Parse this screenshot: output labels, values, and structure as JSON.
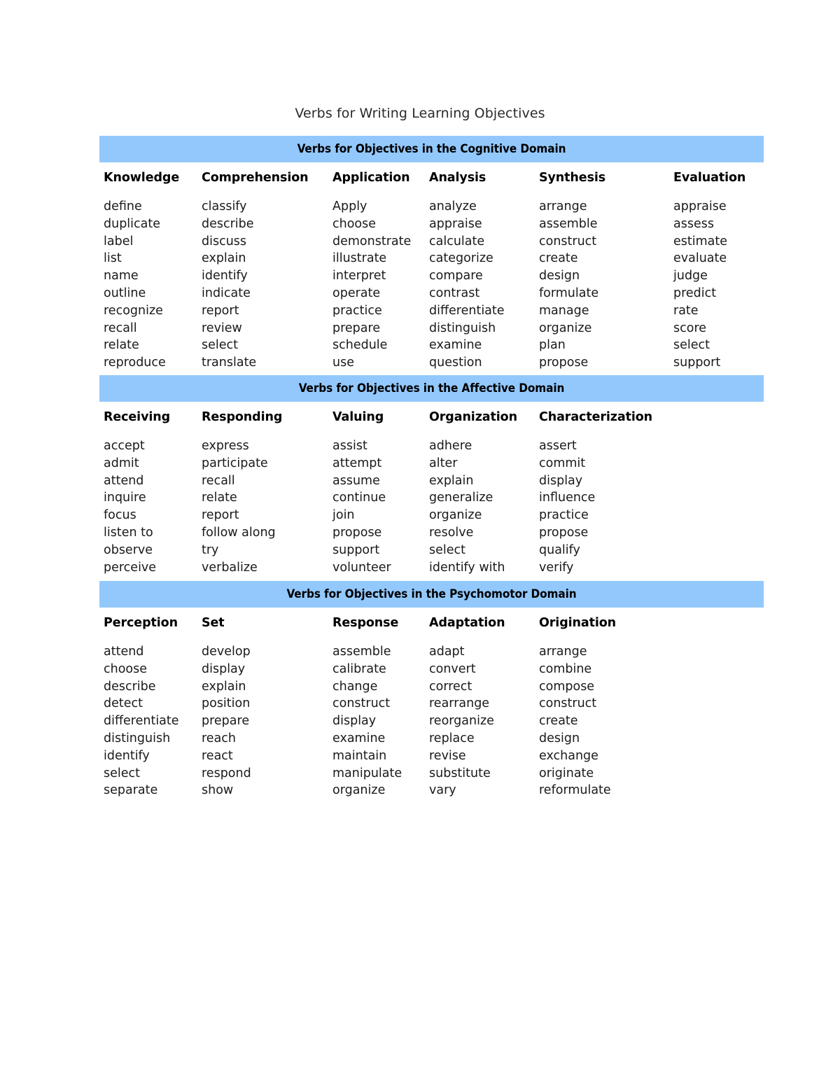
{
  "document": {
    "title": "Verbs for Writing Learning Objectives",
    "band_color": "#93C8FD",
    "text_color": "#000000"
  },
  "sections": [
    {
      "band_title": "Verbs for Objectives in the Cognitive Domain",
      "columns": [
        {
          "header": "Knowledge",
          "words": [
            "define",
            "duplicate",
            "label",
            "list",
            "name",
            "outline",
            "recognize",
            "recall",
            "relate",
            "reproduce"
          ]
        },
        {
          "header": "Comprehension",
          "words": [
            "classify",
            "describe",
            "discuss",
            "explain",
            "identify",
            "indicate",
            "report",
            "review",
            "select",
            "translate"
          ]
        },
        {
          "header": "Application",
          "words": [
            "Apply",
            "choose",
            "demonstrate",
            "illustrate",
            "interpret",
            "operate",
            "practice",
            "prepare",
            "schedule",
            "use"
          ]
        },
        {
          "header": "Analysis",
          "words": [
            "analyze",
            "appraise",
            "calculate",
            "categorize",
            "compare",
            "contrast",
            "differentiate",
            "distinguish",
            "examine",
            "question"
          ]
        },
        {
          "header": "Synthesis",
          "words": [
            "arrange",
            "assemble",
            "construct",
            "create",
            "design",
            "formulate",
            "manage",
            "organize",
            "plan",
            "propose"
          ]
        },
        {
          "header": "Evaluation",
          "words": [
            "appraise",
            "assess",
            "estimate",
            "evaluate",
            "judge",
            "predict",
            "rate",
            "score",
            "select",
            "support"
          ]
        }
      ]
    },
    {
      "band_title": "Verbs for Objectives in the Affective Domain",
      "columns": [
        {
          "header": "Receiving",
          "words": [
            "accept",
            "admit",
            "attend",
            "inquire",
            "focus",
            "listen to",
            "observe",
            "perceive"
          ]
        },
        {
          "header": "Responding",
          "words": [
            "express",
            "participate",
            "recall",
            "relate",
            "report",
            "follow along",
            "try",
            "verbalize"
          ]
        },
        {
          "header": "Valuing",
          "words": [
            "assist",
            "attempt",
            "assume",
            "continue",
            "join",
            "propose",
            "support",
            "volunteer"
          ]
        },
        {
          "header": "Organization",
          "words": [
            "adhere",
            "alter",
            "explain",
            "generalize",
            "organize",
            "resolve",
            "select",
            "identify with"
          ]
        },
        {
          "header": "Characterization",
          "words": [
            "assert",
            "commit",
            "display",
            "influence",
            "practice",
            "propose",
            "qualify",
            "verify"
          ]
        }
      ]
    },
    {
      "band_title": "Verbs for Objectives in the Psychomotor Domain",
      "columns": [
        {
          "header": "Perception",
          "words": [
            "attend",
            "choose",
            "describe",
            "detect",
            "differentiate",
            "distinguish",
            "identify",
            "select",
            "separate"
          ]
        },
        {
          "header": "Set",
          "words": [
            "develop",
            "display",
            "explain",
            "position",
            "prepare",
            "reach",
            "react",
            "respond",
            "show"
          ]
        },
        {
          "header": "Response",
          "words": [
            "assemble",
            "calibrate",
            "change",
            "construct",
            "display",
            "examine",
            "maintain",
            "manipulate",
            "organize"
          ]
        },
        {
          "header": "Adaptation",
          "words": [
            "adapt",
            "convert",
            "correct",
            "rearrange",
            "reorganize",
            "replace",
            "revise",
            "substitute",
            "vary"
          ]
        },
        {
          "header": "Origination",
          "words": [
            "arrange",
            "combine",
            "compose",
            "construct",
            "create",
            "design",
            "exchange",
            "originate",
            "reformulate"
          ]
        }
      ]
    }
  ]
}
